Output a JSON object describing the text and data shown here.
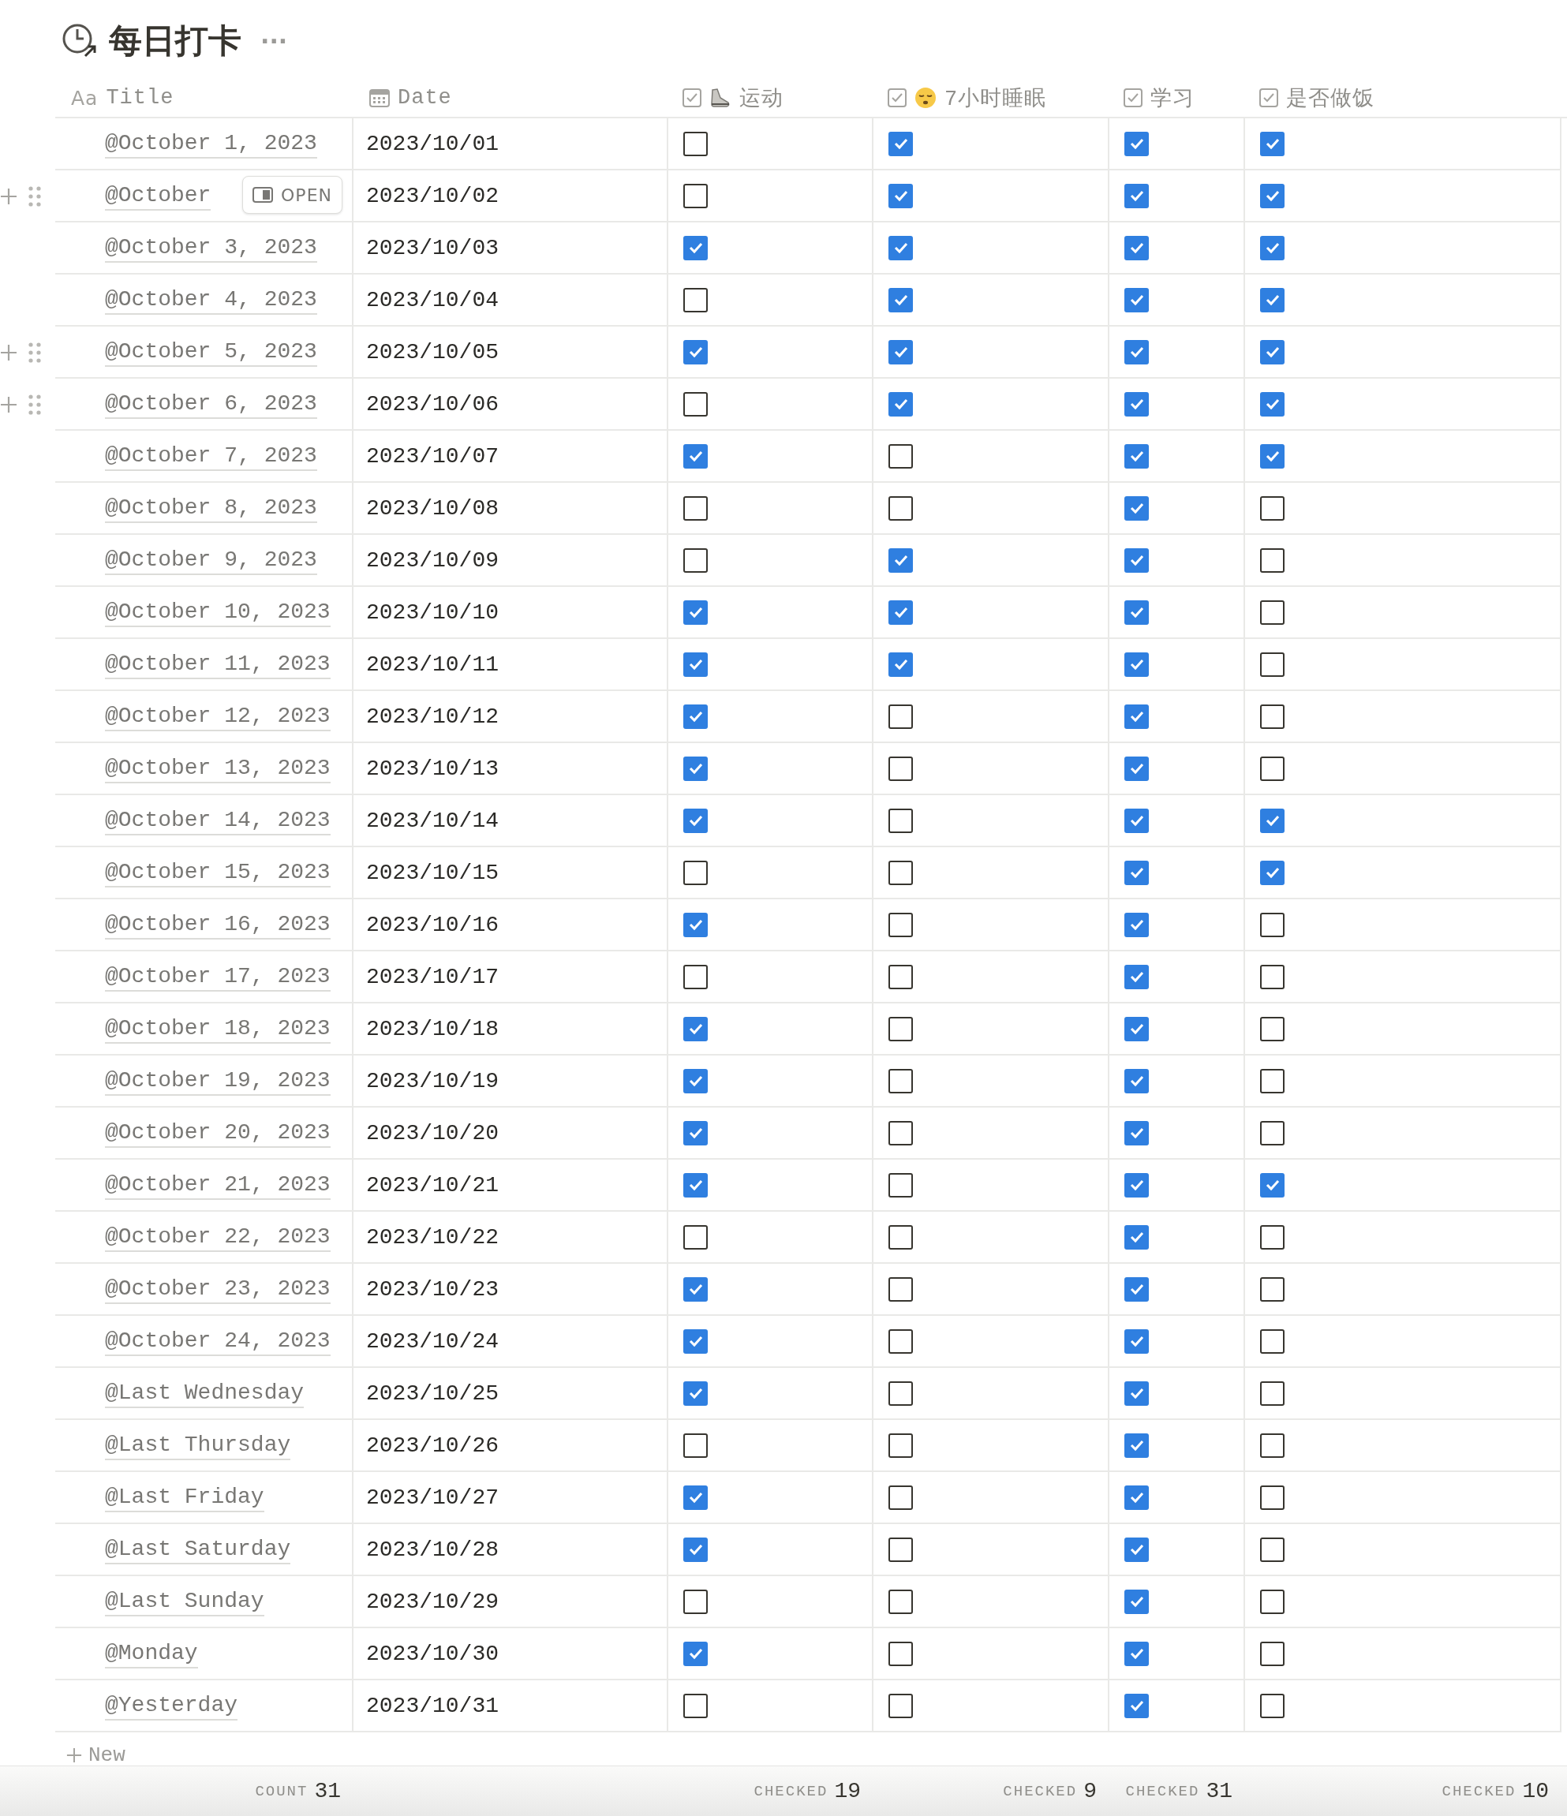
{
  "page": {
    "title": "每日打卡",
    "more": "···"
  },
  "columns": [
    {
      "kind": "title",
      "type_label": "Aa",
      "label": "Title"
    },
    {
      "kind": "date",
      "label": "Date"
    },
    {
      "kind": "checkbox",
      "label": "运动"
    },
    {
      "kind": "checkbox",
      "label": "7小时睡眠"
    },
    {
      "kind": "checkbox",
      "label": "学习"
    },
    {
      "kind": "checkbox",
      "label": "是否做饭"
    }
  ],
  "rows": [
    {
      "title": "@October 1, 2023",
      "date": "2023/10/01",
      "checks": [
        false,
        true,
        true,
        true
      ],
      "handles": false
    },
    {
      "title": "@October",
      "date": "2023/10/02",
      "checks": [
        false,
        true,
        true,
        true
      ],
      "handles": true,
      "open_button": "OPEN"
    },
    {
      "title": "@October 3, 2023",
      "date": "2023/10/03",
      "checks": [
        true,
        true,
        true,
        true
      ],
      "handles": false
    },
    {
      "title": "@October 4, 2023",
      "date": "2023/10/04",
      "checks": [
        false,
        true,
        true,
        true
      ],
      "handles": false
    },
    {
      "title": "@October 5, 2023",
      "date": "2023/10/05",
      "checks": [
        true,
        true,
        true,
        true
      ],
      "handles": true
    },
    {
      "title": "@October 6, 2023",
      "date": "2023/10/06",
      "checks": [
        false,
        true,
        true,
        true
      ],
      "handles": true
    },
    {
      "title": "@October 7, 2023",
      "date": "2023/10/07",
      "checks": [
        true,
        false,
        true,
        true
      ],
      "handles": false
    },
    {
      "title": "@October 8, 2023",
      "date": "2023/10/08",
      "checks": [
        false,
        false,
        true,
        false
      ],
      "handles": false
    },
    {
      "title": "@October 9, 2023",
      "date": "2023/10/09",
      "checks": [
        false,
        true,
        true,
        false
      ],
      "handles": false
    },
    {
      "title": "@October 10, 2023",
      "date": "2023/10/10",
      "checks": [
        true,
        true,
        true,
        false
      ],
      "handles": false
    },
    {
      "title": "@October 11, 2023",
      "date": "2023/10/11",
      "checks": [
        true,
        true,
        true,
        false
      ],
      "handles": false
    },
    {
      "title": "@October 12, 2023",
      "date": "2023/10/12",
      "checks": [
        true,
        false,
        true,
        false
      ],
      "handles": false
    },
    {
      "title": "@October 13, 2023",
      "date": "2023/10/13",
      "checks": [
        true,
        false,
        true,
        false
      ],
      "handles": false
    },
    {
      "title": "@October 14, 2023",
      "date": "2023/10/14",
      "checks": [
        true,
        false,
        true,
        true
      ],
      "handles": false
    },
    {
      "title": "@October 15, 2023",
      "date": "2023/10/15",
      "checks": [
        false,
        false,
        true,
        true
      ],
      "handles": false
    },
    {
      "title": "@October 16, 2023",
      "date": "2023/10/16",
      "checks": [
        true,
        false,
        true,
        false
      ],
      "handles": false
    },
    {
      "title": "@October 17, 2023",
      "date": "2023/10/17",
      "checks": [
        false,
        false,
        true,
        false
      ],
      "handles": false
    },
    {
      "title": "@October 18, 2023",
      "date": "2023/10/18",
      "checks": [
        true,
        false,
        true,
        false
      ],
      "handles": false
    },
    {
      "title": "@October 19, 2023",
      "date": "2023/10/19",
      "checks": [
        true,
        false,
        true,
        false
      ],
      "handles": false
    },
    {
      "title": "@October 20, 2023",
      "date": "2023/10/20",
      "checks": [
        true,
        false,
        true,
        false
      ],
      "handles": false
    },
    {
      "title": "@October 21, 2023",
      "date": "2023/10/21",
      "checks": [
        true,
        false,
        true,
        true
      ],
      "handles": false
    },
    {
      "title": "@October 22, 2023",
      "date": "2023/10/22",
      "checks": [
        false,
        false,
        true,
        false
      ],
      "handles": false
    },
    {
      "title": "@October 23, 2023",
      "date": "2023/10/23",
      "checks": [
        true,
        false,
        true,
        false
      ],
      "handles": false
    },
    {
      "title": "@October 24, 2023",
      "date": "2023/10/24",
      "checks": [
        true,
        false,
        true,
        false
      ],
      "handles": false
    },
    {
      "title": "@Last Wednesday",
      "date": "2023/10/25",
      "checks": [
        true,
        false,
        true,
        false
      ],
      "handles": false
    },
    {
      "title": "@Last Thursday",
      "date": "2023/10/26",
      "checks": [
        false,
        false,
        true,
        false
      ],
      "handles": false
    },
    {
      "title": "@Last Friday",
      "date": "2023/10/27",
      "checks": [
        true,
        false,
        true,
        false
      ],
      "handles": false
    },
    {
      "title": "@Last Saturday",
      "date": "2023/10/28",
      "checks": [
        true,
        false,
        true,
        false
      ],
      "handles": false
    },
    {
      "title": "@Last Sunday",
      "date": "2023/10/29",
      "checks": [
        false,
        false,
        true,
        false
      ],
      "handles": false
    },
    {
      "title": "@Monday",
      "date": "2023/10/30",
      "checks": [
        true,
        false,
        true,
        false
      ],
      "handles": false
    },
    {
      "title": "@Yesterday",
      "date": "2023/10/31",
      "checks": [
        false,
        false,
        true,
        false
      ],
      "handles": false
    }
  ],
  "new_row": {
    "label": "New"
  },
  "footer": {
    "title_column": {
      "label": "COUNT",
      "value": "31"
    },
    "checkbox_columns": [
      {
        "label": "CHECKED",
        "value": "19"
      },
      {
        "label": "CHECKED",
        "value": "9"
      },
      {
        "label": "CHECKED",
        "value": "31"
      },
      {
        "label": "CHECKED",
        "value": "10"
      }
    ]
  }
}
